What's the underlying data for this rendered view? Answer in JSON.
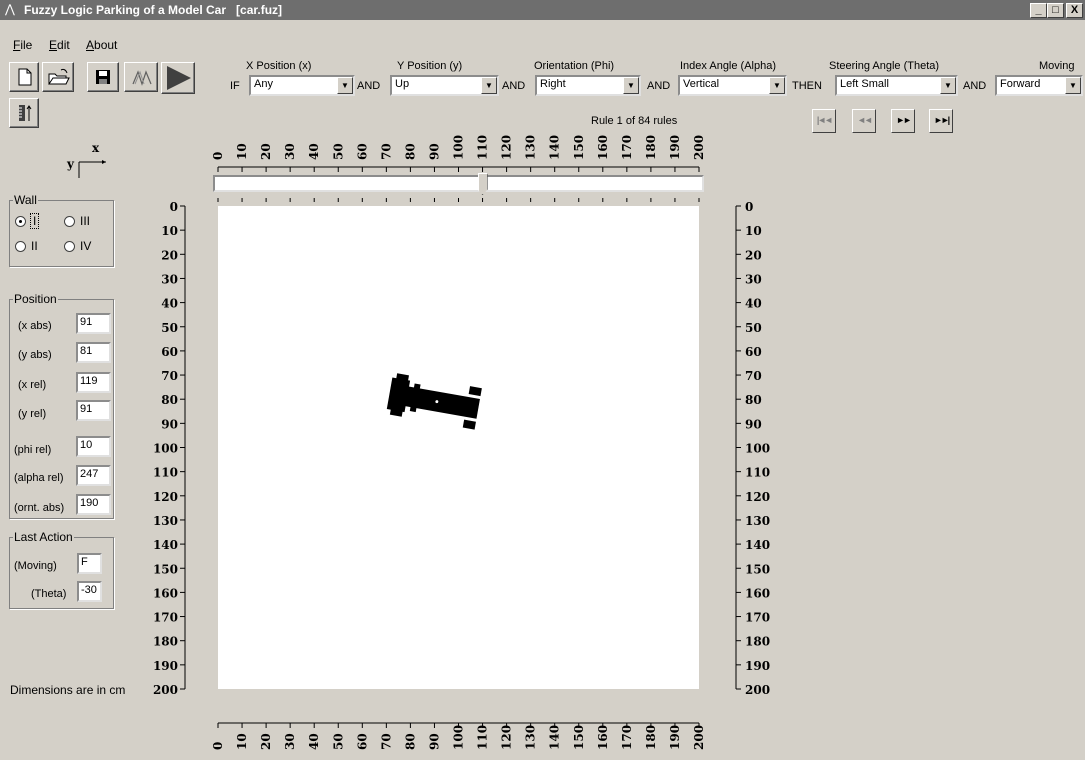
{
  "window": {
    "title": "Fuzzy Logic Parking of a Model Car   [car.fuz]",
    "controls": [
      "_",
      "□",
      "X"
    ]
  },
  "menu": [
    {
      "label": "File",
      "accel": "F",
      "rest": "ile"
    },
    {
      "label": "Edit",
      "accel": "E",
      "rest": "dit"
    },
    {
      "label": "About",
      "accel": "A",
      "rest": "bout"
    }
  ],
  "toolbar": {
    "buttons": [
      "new-file-icon",
      "open-folder-icon",
      "save-disk-icon",
      "membership-functions-icon",
      "run-play-icon",
      "ruler-adjust-icon"
    ]
  },
  "rule_editor": {
    "if_kw": "IF",
    "and_kw": "AND",
    "then_kw": "THEN",
    "columns": [
      {
        "header": "X Position (x)",
        "value": "Any"
      },
      {
        "header": "Y Position (y)",
        "value": "Up"
      },
      {
        "header": "Orientation (Phi)",
        "value": "Right"
      },
      {
        "header": "Index Angle (Alpha)",
        "value": "Vertical"
      },
      {
        "header": "Steering Angle (Theta)",
        "value": "Left Small"
      },
      {
        "header": "Moving",
        "value": "Forward"
      }
    ],
    "rule_status": "Rule 1 of 84 rules",
    "nav": [
      "first-rule-icon",
      "previous-rule-icon",
      "next-rule-icon",
      "last-rule-icon"
    ],
    "nav_glyphs": [
      "|◄◄",
      "◄◄",
      "►►",
      "►►|"
    ]
  },
  "axes_indicator": {
    "x": "x",
    "y": "y"
  },
  "wall": {
    "label": "Wall",
    "options": [
      {
        "label": "I",
        "selected": true
      },
      {
        "label": "III",
        "selected": false
      },
      {
        "label": "II",
        "selected": false
      },
      {
        "label": "IV",
        "selected": false
      }
    ]
  },
  "position": {
    "label": "Position",
    "fields": [
      {
        "label": "(x abs)",
        "value": "91"
      },
      {
        "label": "(y abs)",
        "value": "81"
      },
      {
        "label": "(x rel)",
        "value": "119"
      },
      {
        "label": "(y rel)",
        "value": "91"
      },
      {
        "label": "(phi rel)",
        "value": "10"
      },
      {
        "label": "(alpha rel)",
        "value": "247"
      },
      {
        "label": "(ornt. abs)",
        "value": "190"
      }
    ]
  },
  "last_action": {
    "label": "Last Action",
    "fields": [
      {
        "label": "(Moving)",
        "value": "F"
      },
      {
        "label": "(Theta)",
        "value": "-30"
      }
    ]
  },
  "footer_note": "Dimensions are in cm",
  "scale": {
    "ticks": [
      "0",
      "10",
      "20",
      "30",
      "40",
      "50",
      "60",
      "70",
      "80",
      "90",
      "100",
      "110",
      "120",
      "130",
      "140",
      "150",
      "160",
      "170",
      "180",
      "190",
      "200"
    ],
    "slider_value": 110
  },
  "car": {
    "x": 91,
    "y": 81,
    "orientation": 190
  }
}
